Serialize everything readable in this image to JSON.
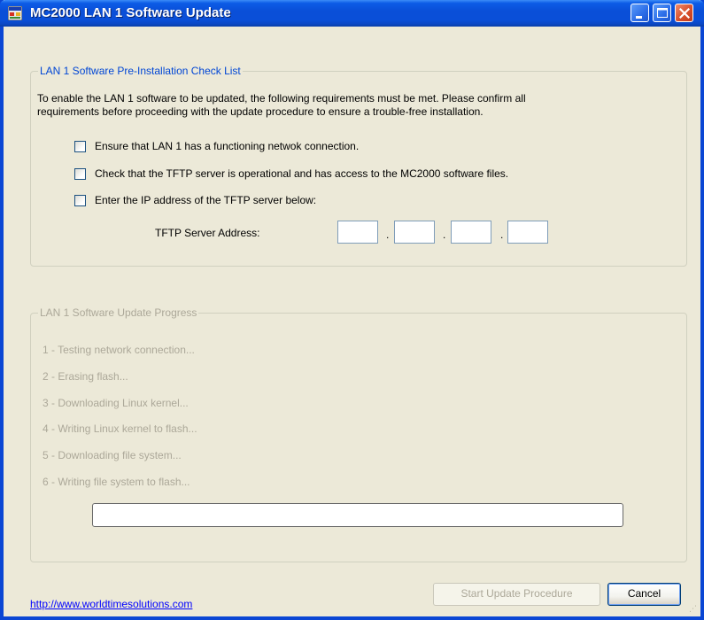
{
  "window": {
    "title": "MC2000 LAN 1 Software Update"
  },
  "checklist": {
    "legend": "LAN 1 Software Pre-Installation Check List",
    "intro_line1": "To enable the LAN 1 software to be updated, the following requirements must be met.  Please confirm all",
    "intro_line2": "requirements before proceeding with the update procedure to ensure a trouble-free installation.",
    "items": [
      {
        "label": "Ensure that LAN 1 has a functioning netwok connection.",
        "checked": false
      },
      {
        "label": "Check that the TFTP server is operational and has access to the MC2000 software files.",
        "checked": false
      },
      {
        "label": "Enter the IP address of the TFTP server below:",
        "checked": false
      }
    ],
    "tftp_label": "TFTP Server Address:",
    "ip_octets": [
      "",
      "",
      "",
      ""
    ],
    "ip_separator": "."
  },
  "progress": {
    "legend": "LAN 1 Software Update Progress",
    "steps": [
      "1 - Testing network connection...",
      "2 - Erasing flash...",
      "3 - Downloading Linux kernel...",
      "4 - Writing Linux kernel to flash...",
      "5 - Downloading file system...",
      "6 - Writing file system to flash..."
    ],
    "bar_fraction": 0
  },
  "footer": {
    "link": "http://www.worldtimesolutions.com",
    "start_label": "Start Update Procedure",
    "cancel_label": "Cancel"
  },
  "icons": {
    "app": "app-icon",
    "minimize": "minimize-icon",
    "maximize": "maximize-icon",
    "close": "close-icon",
    "grip": "resize-grip-icon"
  },
  "colors": {
    "titlebar": "#0a4fd8",
    "legend_active": "#0046d5",
    "disabled_text": "#aca899",
    "link": "#0000ff"
  }
}
